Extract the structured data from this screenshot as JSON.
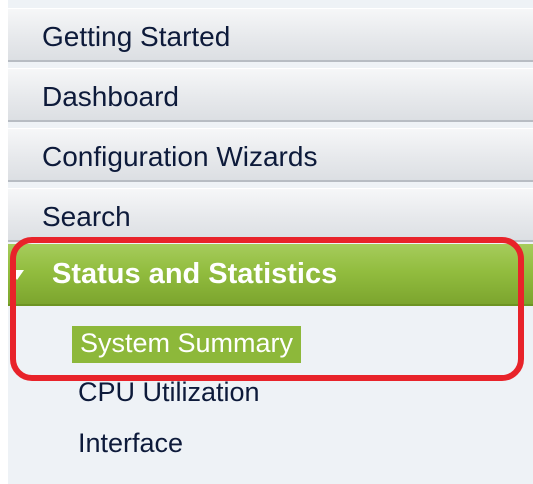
{
  "nav": {
    "items": [
      {
        "label": "Getting Started"
      },
      {
        "label": "Dashboard"
      },
      {
        "label": "Configuration Wizards"
      },
      {
        "label": "Search"
      }
    ],
    "active_section": {
      "label": "Status and Statistics",
      "expanded": true
    },
    "sub_items": [
      {
        "label": "System Summary",
        "selected": true
      },
      {
        "label": "CPU Utilization"
      },
      {
        "label": "Interface"
      }
    ]
  },
  "colors": {
    "active_green": "#92bd3f",
    "highlight_red": "#e8232a",
    "text_navy": "#0d1a3a"
  }
}
